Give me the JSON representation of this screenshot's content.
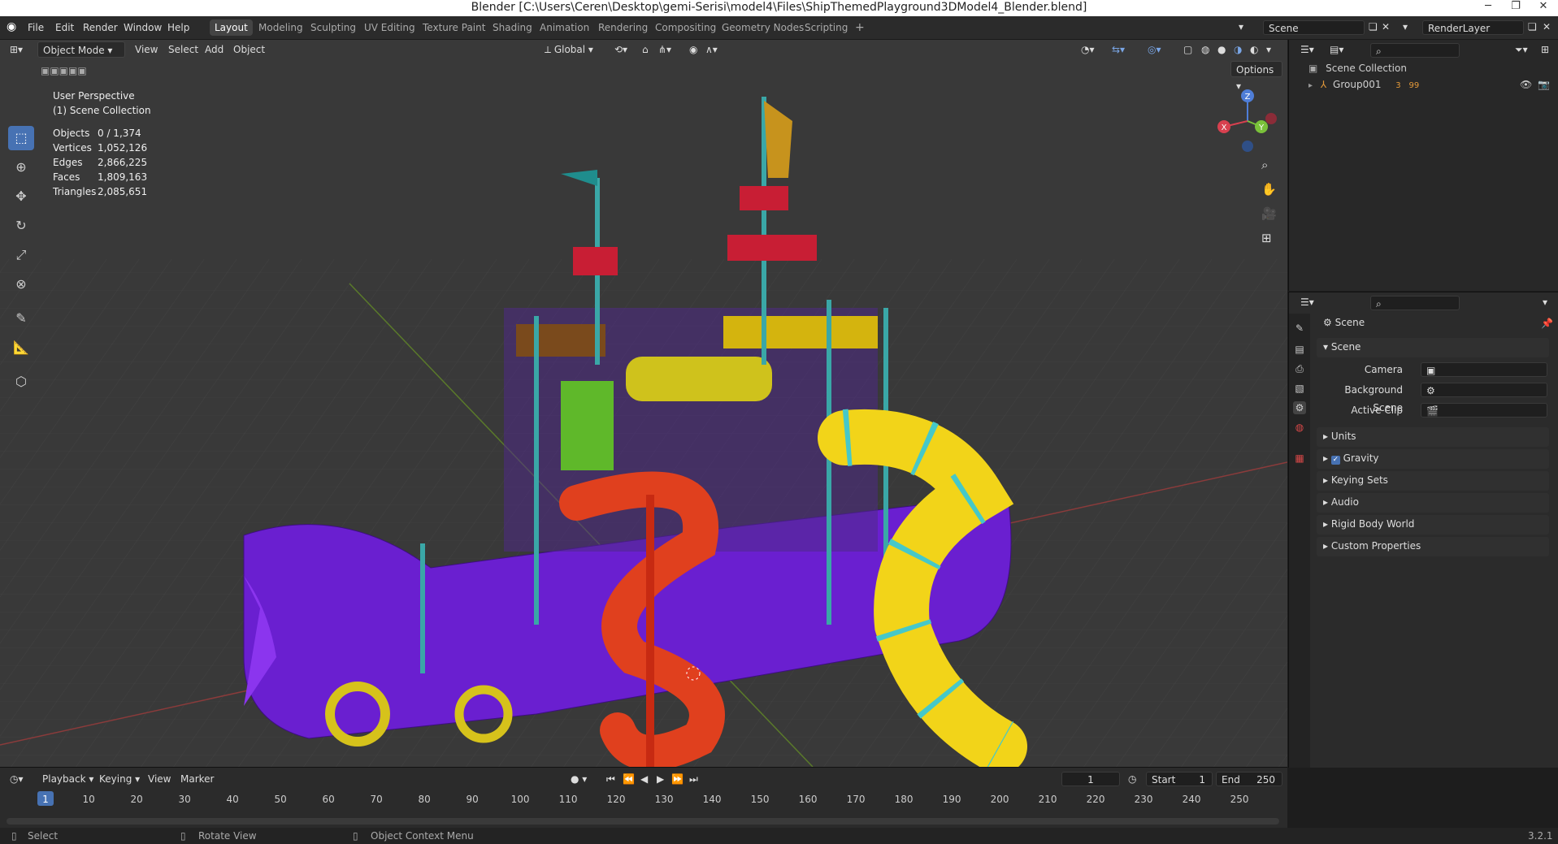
{
  "window": {
    "title": "Blender [C:\\Users\\Ceren\\Desktop\\gemi-Serisi\\model4\\Files\\ShipThemedPlayground3DModel4_Blender.blend]"
  },
  "menu": [
    "File",
    "Edit",
    "Render",
    "Window",
    "Help"
  ],
  "workspaces": [
    "Layout",
    "Modeling",
    "Sculpting",
    "UV Editing",
    "Texture Paint",
    "Shading",
    "Animation",
    "Rendering",
    "Compositing",
    "Geometry Nodes",
    "Scripting"
  ],
  "active_workspace": "Layout",
  "scene_field": "Scene",
  "renderlayer_field": "RenderLayer",
  "viewport_header": {
    "mode": "Object Mode",
    "view": "View",
    "select": "Select",
    "add": "Add",
    "object": "Object",
    "orientation": "Global",
    "options": "Options"
  },
  "overlay": {
    "perspective": "User Perspective",
    "collection": "(1) Scene Collection"
  },
  "stats": [
    {
      "label": "Objects",
      "value": "0 / 1,374"
    },
    {
      "label": "Vertices",
      "value": "1,052,126"
    },
    {
      "label": "Edges",
      "value": "2,866,225"
    },
    {
      "label": "Faces",
      "value": "1,809,163"
    },
    {
      "label": "Triangles",
      "value": "2,085,651"
    }
  ],
  "gizmo": {
    "x": "X",
    "y": "Y",
    "z": "Z"
  },
  "outliner": {
    "root": "Scene Collection",
    "item": "Group001",
    "badge1": "3",
    "badge2": "99"
  },
  "properties": {
    "header": "Scene",
    "section": "Scene",
    "camera_label": "Camera",
    "background_label": "Background Scene",
    "clip_label": "Active Clip",
    "panels": [
      "Units",
      "Gravity",
      "Keying Sets",
      "Audio",
      "Rigid Body World",
      "Custom Properties"
    ]
  },
  "timeline": {
    "menus": [
      "Playback",
      "Keying",
      "View",
      "Marker"
    ],
    "current_frame": "1",
    "start_label": "Start",
    "start": "1",
    "end_label": "End",
    "end": "250",
    "ticks": [
      "1",
      "10",
      "20",
      "30",
      "40",
      "50",
      "60",
      "70",
      "80",
      "90",
      "100",
      "110",
      "120",
      "130",
      "140",
      "150",
      "160",
      "170",
      "180",
      "190",
      "200",
      "210",
      "220",
      "230",
      "240",
      "250"
    ]
  },
  "statusbar": {
    "select": "Select",
    "rotate": "Rotate View",
    "context": "Object Context Menu",
    "version": "3.2.1"
  }
}
